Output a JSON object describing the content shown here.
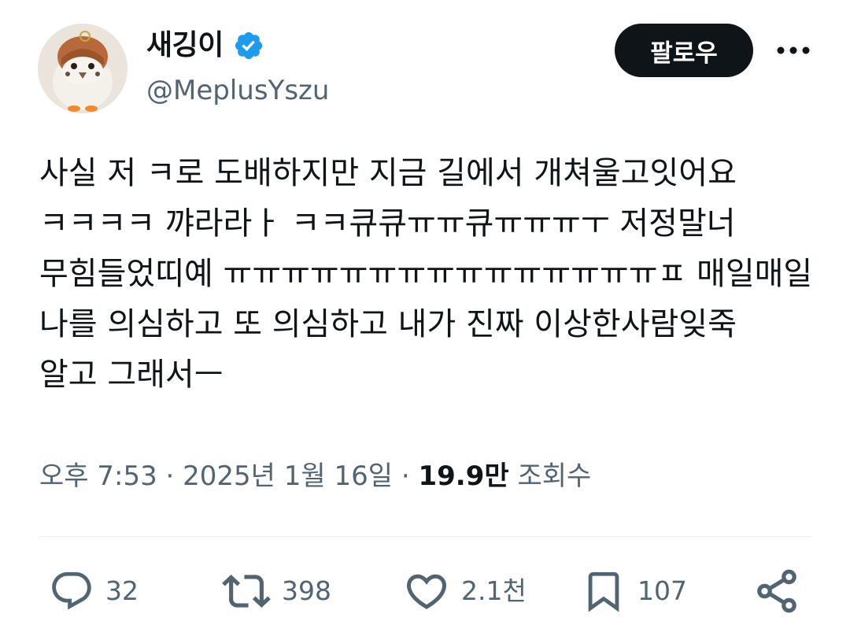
{
  "user": {
    "display_name": "새깅이",
    "handle": "@MeplusYszu",
    "verified": true,
    "avatar_icon": "sparrow-plush-avatar"
  },
  "header": {
    "follow_label": "팔로우",
    "more_icon": "more-horizontal-icon"
  },
  "tweet": {
    "lines": [
      "사실 저 ㅋ로 도배하지만 지금 길에서 개쳐울고잇어요",
      "ㅋㅋㅋㅋ 꺄라라ㅏ ㅋㅋ큐큐ㅠㅠ큐ㅠㅠㅠㅜ 저정말너",
      "무힘들었띠예 ㅠㅠㅠㅠㅠㅠㅠㅠㅠㅠㅠㅠㅠㅠㅠㅍ 매일매일",
      "나를 의심하고 또 의심하고 내가 진짜 이상한사람잊죽",
      "알고 그래서ㅡ"
    ]
  },
  "meta": {
    "time": "오후 7:53",
    "separator": " · ",
    "date": "2025년 1월 16일",
    "views_count": "19.9만",
    "views_label": "조회수"
  },
  "actions": {
    "reply": {
      "icon": "reply-bubble-icon",
      "count": "32"
    },
    "retweet": {
      "icon": "retweet-icon",
      "count": "398"
    },
    "like": {
      "icon": "heart-icon",
      "count": "2.1천"
    },
    "bookmark": {
      "icon": "bookmark-icon",
      "count": "107"
    },
    "share": {
      "icon": "share-icon"
    }
  },
  "colors": {
    "text_primary": "#0f1419",
    "text_secondary": "#536471",
    "verified_blue": "#1d9bf0",
    "divider": "#eff3f4",
    "follow_bg": "#0f1419"
  }
}
